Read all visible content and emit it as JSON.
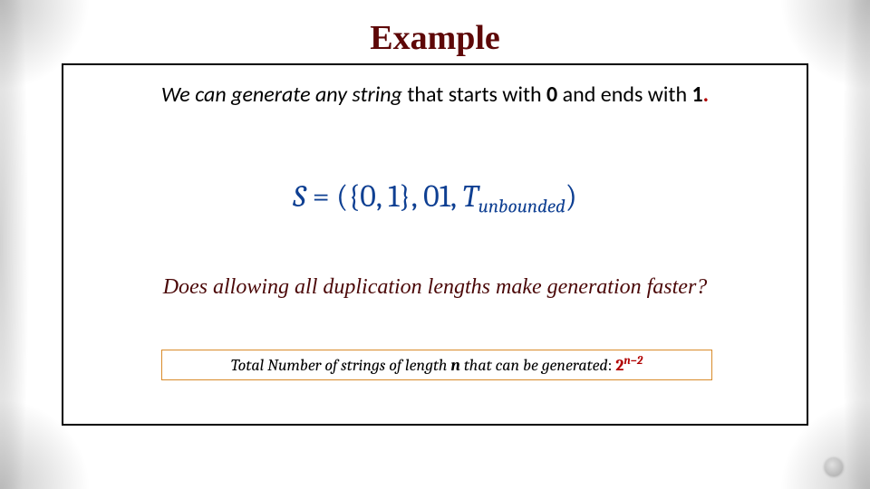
{
  "title": "Example",
  "sentence": {
    "part1_italic": "We can generate any string",
    "part2_plain": " that starts with ",
    "zero": "0",
    "part3_plain": " and ends with ",
    "one": "1",
    "period": "."
  },
  "formula": {
    "S": "S",
    "equals": " = ",
    "open": "(",
    "set": "{0, 1}",
    "comma1": ", ",
    "seed": "01",
    "comma2": ", ",
    "T": "T",
    "T_sub": "unbounded",
    "close": ")"
  },
  "question": "Does allowing all duplication lengths make generation faster?",
  "total": {
    "lead": "Total Number of strings of length ",
    "n": "n",
    "tail": " that can be generated",
    "colon": ": ",
    "base": "2",
    "exp": "n−2"
  }
}
